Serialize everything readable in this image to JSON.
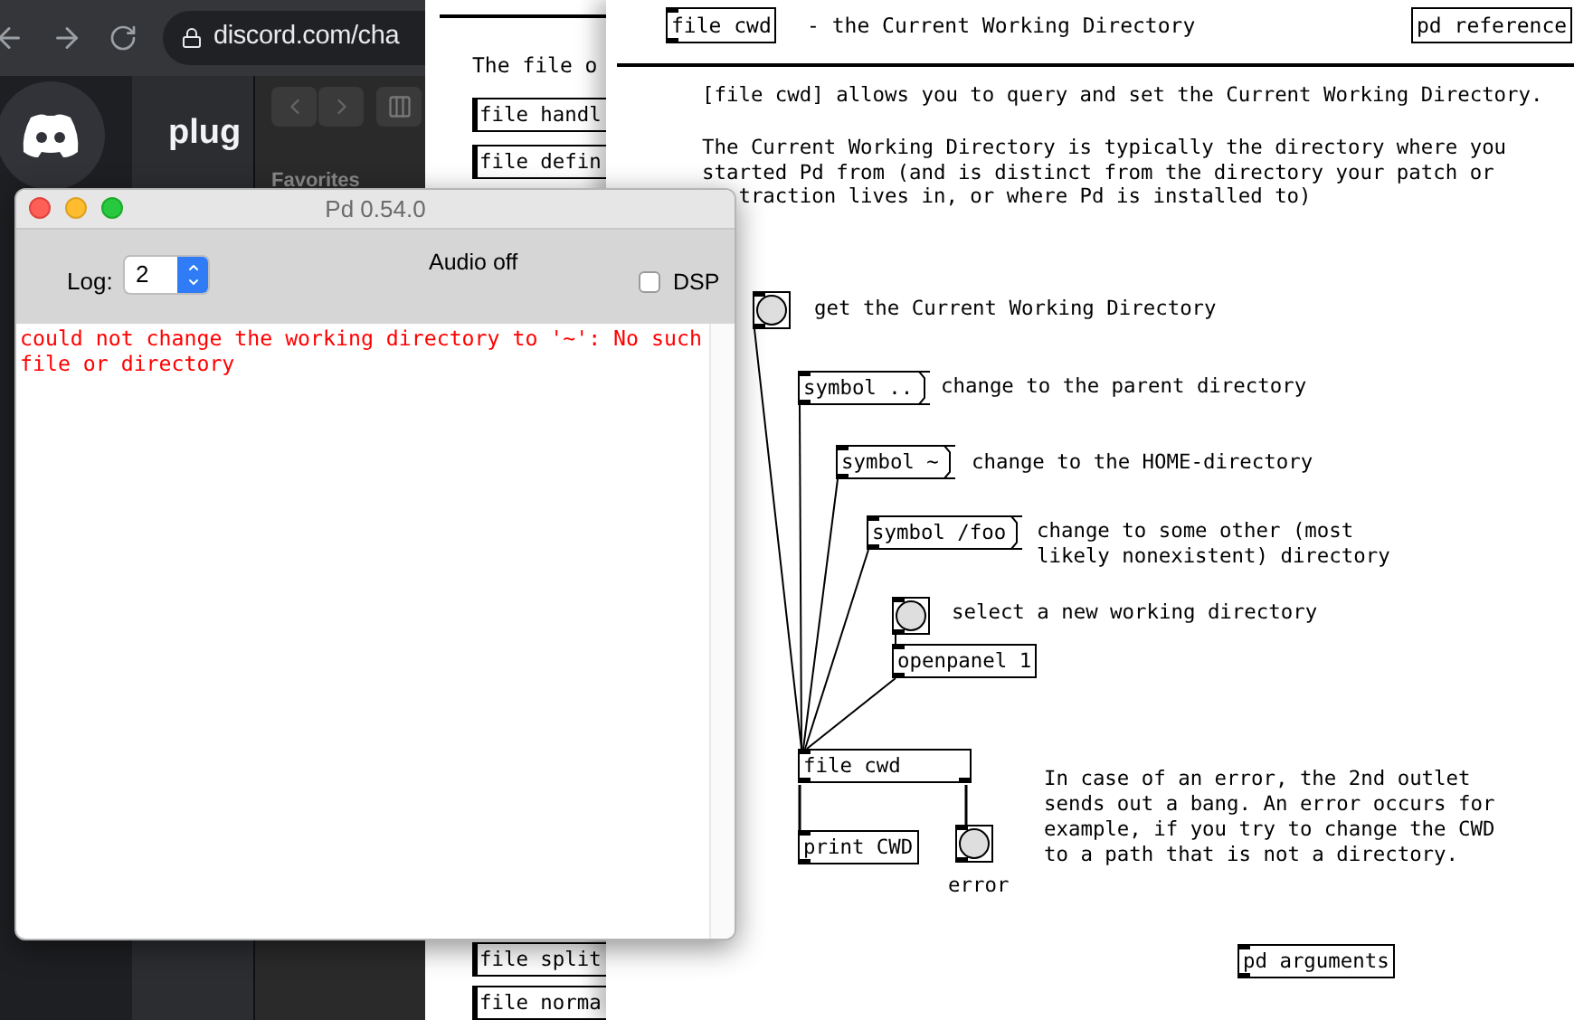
{
  "browser": {
    "url": "discord.com/cha"
  },
  "discord": {
    "server_name": "plug",
    "section": "Favorites"
  },
  "back_patch": {
    "intro": "The file o",
    "objects": [
      "file handl",
      "file defin",
      "file split",
      "file norma"
    ]
  },
  "help_patch": {
    "title_object": "file cwd",
    "title": "- the Current Working Directory",
    "reference": "pd reference",
    "paragraphs": [
      {
        "lines": [
          "[file cwd] allows you to query and set the Current Working Directory."
        ]
      },
      {
        "lines": [
          "The Current Working Directory is typically the directory where you",
          "started Pd from (and is distinct from the directory your patch or",
          "traction lives in, or where Pd is installed to)"
        ]
      }
    ],
    "nodes": [
      {
        "kind": "bang"
      },
      {
        "kind": "comment",
        "text": "get the Current Working Directory"
      },
      {
        "kind": "message",
        "text": "symbol .."
      },
      {
        "kind": "comment",
        "text": "change to the parent directory"
      },
      {
        "kind": "message",
        "text": "symbol ~"
      },
      {
        "kind": "comment",
        "text": "change to the HOME-directory"
      },
      {
        "kind": "message",
        "text": "symbol /foo"
      },
      {
        "kind": "comment",
        "text": "change to some other (most likely nonexistent) directory"
      },
      {
        "kind": "bang"
      },
      {
        "kind": "comment",
        "text": "select a new working directory"
      },
      {
        "kind": "object",
        "text": "openpanel 1"
      },
      {
        "kind": "object",
        "text": "file cwd"
      },
      {
        "kind": "object",
        "text": "print CWD"
      },
      {
        "kind": "bang"
      },
      {
        "kind": "comment",
        "text": "In case of an error, the 2nd outlet sends out a bang. An error occurs for example, if you try to change the CWD to a path that is not a directory."
      },
      {
        "kind": "comment",
        "text": "error"
      },
      {
        "kind": "object",
        "text": "pd arguments"
      }
    ]
  },
  "console": {
    "title": "Pd 0.54.0",
    "log_label": "Log:",
    "log_level": "2",
    "audio_status": "Audio off",
    "dsp": {
      "label": "DSP",
      "checked": false
    },
    "messages": [
      {
        "kind": "error",
        "text": "could not change the working directory to '~': No such file or directory"
      }
    ]
  }
}
